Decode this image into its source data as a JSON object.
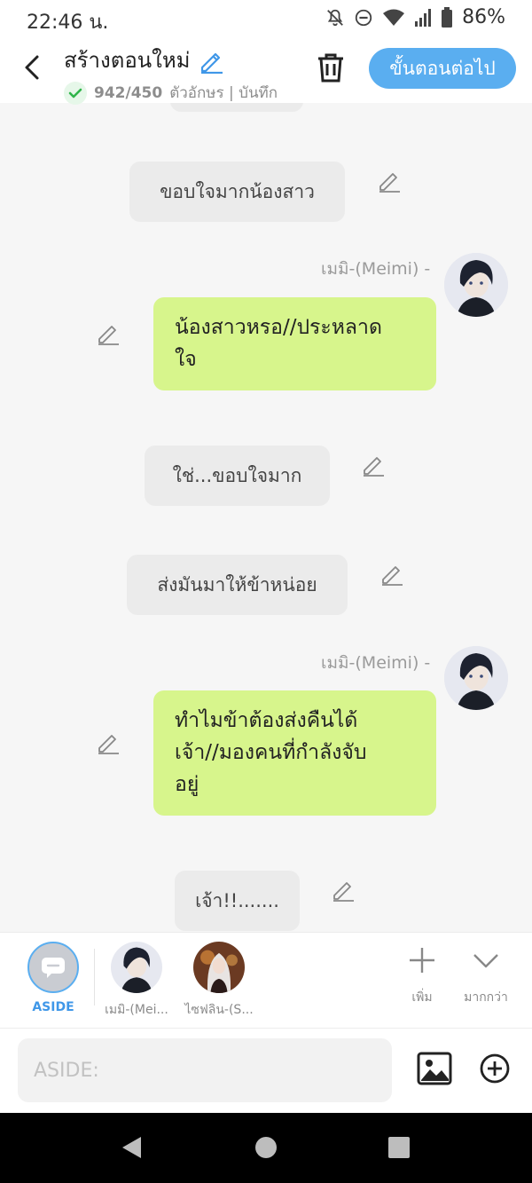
{
  "status_bar": {
    "time": "22:46 น.",
    "battery": "86%",
    "icons": [
      "notifications-off-icon",
      "do-not-disturb-icon",
      "wifi-icon",
      "signal-icon",
      "battery-icon"
    ]
  },
  "header": {
    "title": "สร้างตอนใหม่",
    "char_count": "942/450",
    "status_text": "ตัวอักษร | บันทึก",
    "next_label": "ขั้นตอนต่อไป",
    "accent_color": "#5aaef0"
  },
  "chat": {
    "messages": [
      {
        "type": "narration",
        "text": ""
      },
      {
        "type": "narration",
        "text": "ขอบใจมากน้องสาว"
      },
      {
        "type": "character",
        "speaker": "เมมิ-(Meimi) -",
        "lines": [
          "น้องสาวหรอ//ประหลาด",
          "ใจ"
        ]
      },
      {
        "type": "narration",
        "text": "ใช่...ขอบใจมาก"
      },
      {
        "type": "narration",
        "text": "ส่งมันมาให้ข้าหน่อย"
      },
      {
        "type": "character",
        "speaker": "เมมิ-(Meimi) -",
        "lines": [
          "ทำไมข้าต้องส่งคืนได้",
          "เจ้า//มองคนที่กำลังจับ",
          "อยู่"
        ]
      },
      {
        "type": "narration",
        "text": "เจ้า!!......."
      }
    ],
    "bubble_color": "#d7f58c"
  },
  "characters": {
    "aside_label": "ASIDE",
    "items": [
      {
        "label": "เมมิ-(Mei..."
      },
      {
        "label": "ไซฟลิน-(S..."
      }
    ],
    "add_label": "เพิ่ม",
    "more_label": "มากกว่า"
  },
  "composer": {
    "placeholder": "ASIDE:",
    "value": ""
  }
}
